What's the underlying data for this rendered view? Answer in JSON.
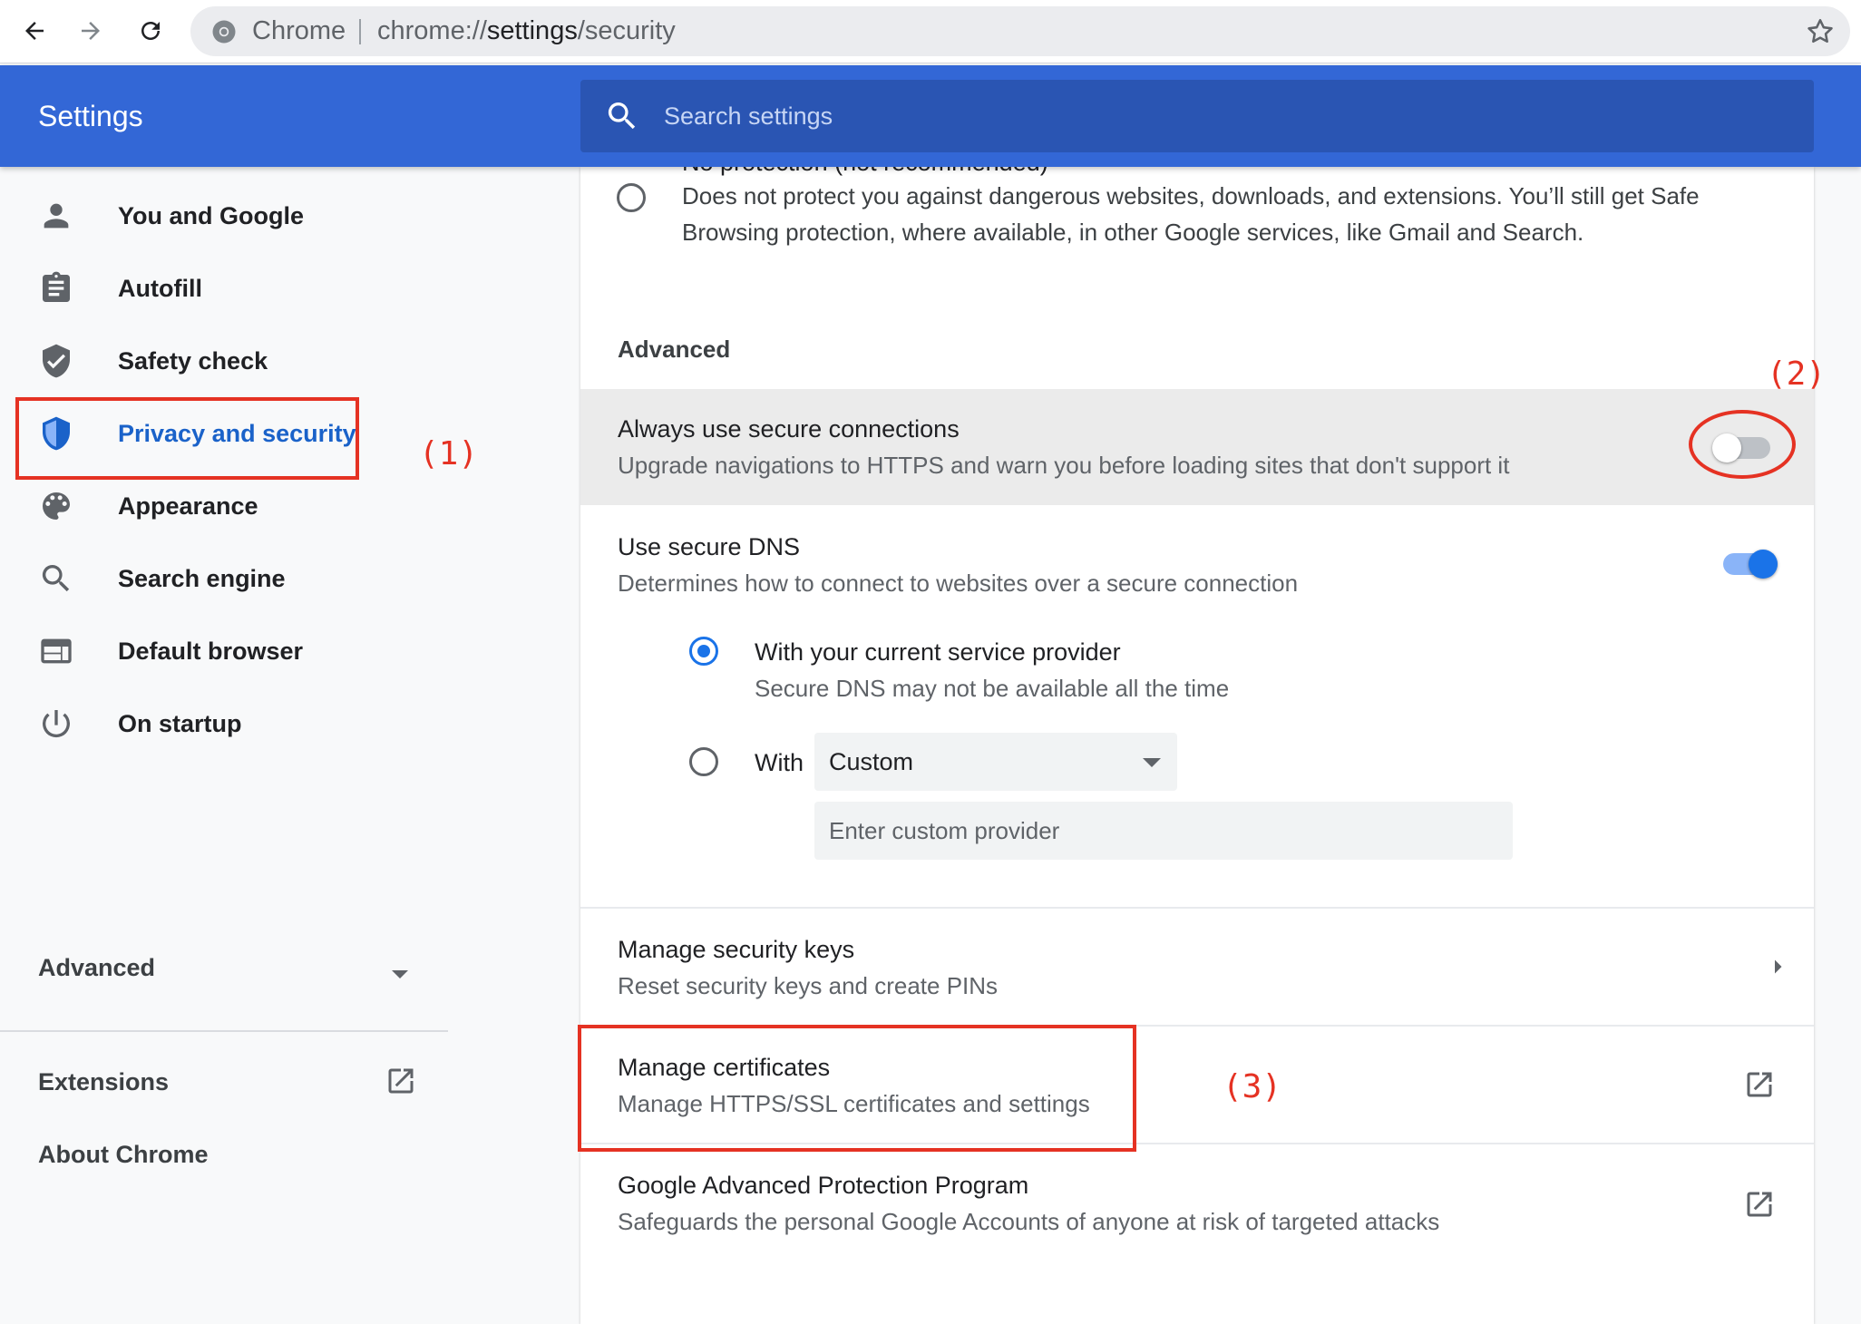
{
  "browser": {
    "chip": "Chrome",
    "url_scheme": "chrome://",
    "url_host": "settings",
    "url_path": "/security"
  },
  "header": {
    "title": "Settings",
    "search_placeholder": "Search settings"
  },
  "sidebar": {
    "items": [
      {
        "label": "You and Google",
        "icon": "person-icon"
      },
      {
        "label": "Autofill",
        "icon": "clipboard-icon"
      },
      {
        "label": "Safety check",
        "icon": "shield-check-icon"
      },
      {
        "label": "Privacy and security",
        "icon": "shield-icon",
        "active": true
      },
      {
        "label": "Appearance",
        "icon": "palette-icon"
      },
      {
        "label": "Search engine",
        "icon": "search-icon"
      },
      {
        "label": "Default browser",
        "icon": "browser-icon"
      },
      {
        "label": "On startup",
        "icon": "power-icon"
      }
    ],
    "advanced_label": "Advanced",
    "extensions_label": "Extensions",
    "about_label": "About Chrome"
  },
  "main": {
    "no_protection": {
      "title": "No protection (not recommended)",
      "desc_line1": "Does not protect you against dangerous websites, downloads, and extensions. You’ll still get Safe",
      "desc_line2": "Browsing protection, where available, in other Google services, like Gmail and Search."
    },
    "advanced_heading": "Advanced",
    "secure_connections": {
      "title": "Always use secure connections",
      "desc": "Upgrade navigations to HTTPS and warn you before loading sites that don't support it",
      "enabled": false
    },
    "secure_dns": {
      "title": "Use secure DNS",
      "desc": "Determines how to connect to websites over a secure connection",
      "enabled": true,
      "option_current_title": "With your current service provider",
      "option_current_desc": "Secure DNS may not be available all the time",
      "option_with_label": "With",
      "provider_selected": "Custom",
      "custom_placeholder": "Enter custom provider"
    },
    "security_keys": {
      "title": "Manage security keys",
      "desc": "Reset security keys and create PINs"
    },
    "certificates": {
      "title": "Manage certificates",
      "desc": "Manage HTTPS/SSL certificates and settings"
    },
    "advanced_protection": {
      "title": "Google Advanced Protection Program",
      "desc": "Safeguards the personal Google Accounts of anyone at risk of targeted attacks"
    }
  },
  "annotations": {
    "label1": "(1)",
    "label2": "(2)",
    "label3": "(3)",
    "color": "#e53223"
  },
  "colors": {
    "header": "#3367d6",
    "accent": "#1a73e8",
    "active_nav": "#1a62c9"
  }
}
